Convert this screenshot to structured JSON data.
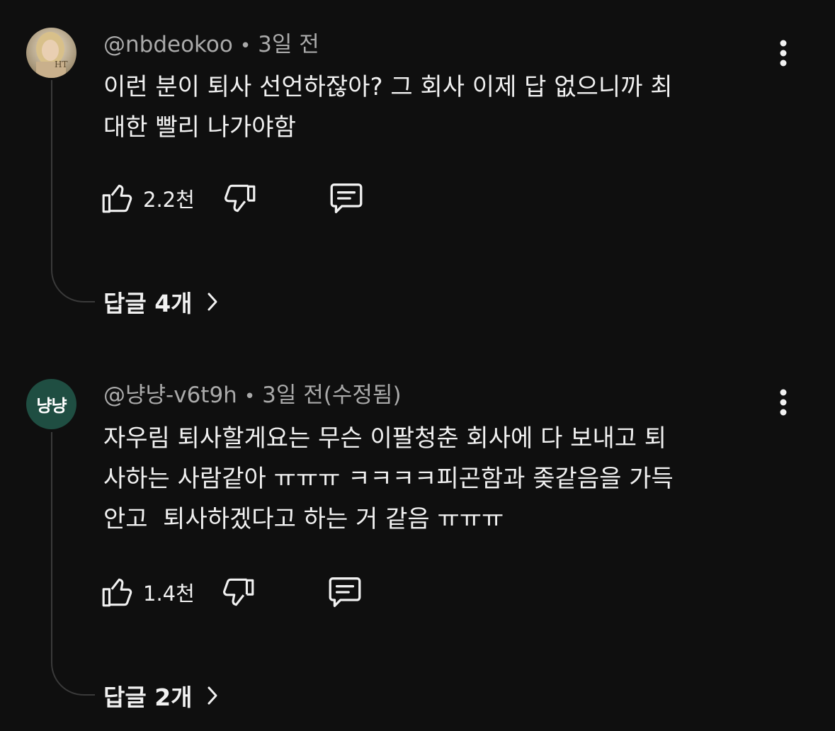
{
  "comments": [
    {
      "author": "@nbdeokoo",
      "time": "3일 전",
      "text": "이런 분이 퇴사 선언하잖아? 그 회사 이제 답 없으니까 최\n대한 빨리 나가야함",
      "likes": "2.2천",
      "replies_label": "답글 4개",
      "avatar_icon": "portrait-photo-icon"
    },
    {
      "author": "@냥냥-v6t9h",
      "time": "3일 전(수정됨)",
      "text": "자우림 퇴사할게요는 무슨 이팔청춘 회사에 다 보내고 퇴\n사하는 사람같아 ㅠㅠㅠ ㅋㅋㅋㅋ피곤함과 좆같음을 가득\n안고  퇴사하겠다고 하는 거 같음 ㅠㅠㅠ",
      "likes": "1.4천",
      "replies_label": "답글 2개",
      "avatar_letter": "냥냥",
      "avatar_color": "#1f4e42"
    }
  ],
  "meta_separator": "•",
  "icons": {
    "like": "thumbs-up-icon",
    "dislike": "thumbs-down-icon",
    "reply": "comment-bubble-icon",
    "more": "more-vertical-icon",
    "expand": "chevron-right-icon"
  },
  "colors": {
    "background": "#0f0f0f",
    "text": "#f1f1f1",
    "secondary_text": "#aaaaaa",
    "thread_line": "#3a3a3a"
  }
}
